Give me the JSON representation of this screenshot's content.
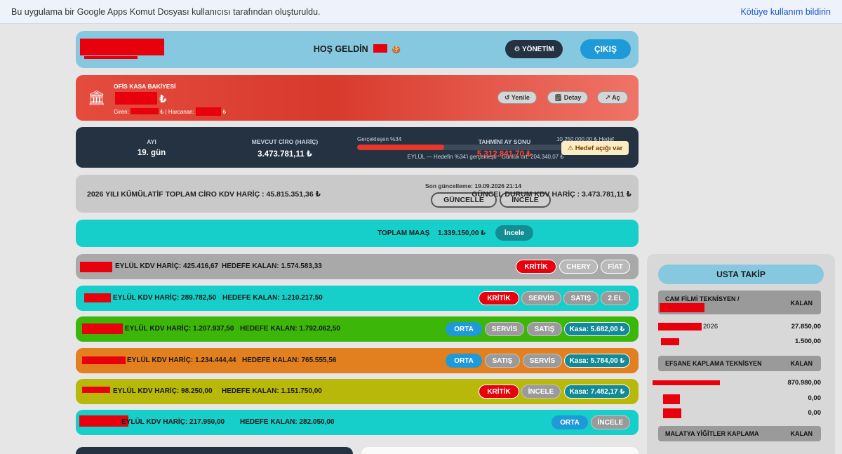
{
  "notice": {
    "text": "Bu uygulama bir Google Apps Komut Dosyası kullanıcısı tarafından oluşturuldu.",
    "report": "Kötüye kullanım bildirin"
  },
  "header": {
    "welcome": "HOŞ GELDİN",
    "icon": "🍪",
    "admin_button": "⚙ YÖNETİM",
    "logout_button": "ÇIKIŞ"
  },
  "kasa": {
    "bank_icon": "🏛",
    "label": "OFİS KASA BAKİYESİ",
    "amount_currency": "₺",
    "giren_label": "Giren:",
    "sep": "₺ | Harcanan:",
    "end": "₺",
    "refresh": "↺ Yenile",
    "detail": "🗒 Detay",
    "open": "↗ Aç"
  },
  "month": {
    "ay_label": "AYI",
    "ay_value": "19. gün",
    "ciro_label": "MEVCUT CİRO (HARİÇ)",
    "ciro_value": "3.473.781,11 ₺",
    "progress_label": "Gerçekleşen %34",
    "target": "10.250.000,00 ₺ Hedef",
    "progress_percent": 34,
    "progress_note": "EYLÜL — Hedefin %34'i gerçekleşti · Günlük ort: 204.340,07 ₺",
    "forecast_label": "TAHMİNİ AY SONU",
    "forecast_value": "5.312.841,70 ₺",
    "gap_badge": "⚠ Hedef açığı var"
  },
  "cumulative": {
    "left": "2026 YILI KÜMÜLATİF TOPLAM CİRO KDV HARİÇ : 45.815.351,36 ₺",
    "updated": "Son güncelleme: 19.09.2026 21:14",
    "refresh_button": "GÜNCELLE",
    "inspect_button": "İNCELE",
    "right": "GÜNCEL DURUM KDV HARİÇ : 3.473.781,11 ₺"
  },
  "salary": {
    "label": "TOPLAM MAAŞ",
    "value": "1.339.150,00 ₺",
    "button": "İncele"
  },
  "branches": [
    {
      "sales": "EYLÜL KDV HARİÇ: 425.416,67",
      "remaining": "HEDEFE KALAN: 1.574.583,33",
      "buttons": [
        "KRİTİK",
        "CHERY",
        "FİAT"
      ]
    },
    {
      "sales": "EYLÜL KDV HARİÇ: 289.782,50",
      "remaining": "HEDEFE KALAN: 1.210.217,50",
      "buttons": [
        "KRİTİK",
        "SERVİS",
        "SATIŞ",
        "2.EL"
      ]
    },
    {
      "sales": "EYLÜL KDV HARİÇ: 1.207.937,50",
      "remaining": "HEDEFE KALAN: 1.792.062,50",
      "buttons": [
        "ORTA",
        "SERVİS",
        "SATIŞ",
        "Kasa: 5.682,00 ₺"
      ]
    },
    {
      "sales": "EYLÜL KDV HARİÇ: 1.234.444,44",
      "remaining": "HEDEFE KALAN: 765.555,56",
      "buttons": [
        "ORTA",
        "SATIŞ",
        "SERVİS",
        "Kasa: 5.784,00 ₺"
      ]
    },
    {
      "sales": "EYLÜL KDV HARİÇ: 98.250,00",
      "remaining": "HEDEFE KALAN: 1.151.750,00",
      "buttons": [
        "KRİTİK",
        "İNCELE",
        "Kasa: 7.482,17 ₺"
      ]
    },
    {
      "sales": "EYLÜL KDV HARİÇ: 217.950,00",
      "remaining": "HEDEFE KALAN: 282.050,00",
      "buttons": [
        "ORTA",
        "İNCELE"
      ]
    }
  ],
  "colors": {
    "branch_1": "#a9a9a9",
    "branch_2": "#17cfca",
    "branch_3": "#3cb609",
    "branch_4": "#e2801f",
    "branch_5": "#b8b80a",
    "branch_6": "#17cfca"
  },
  "usta": {
    "title": "USTA TAKİP",
    "groups": [
      {
        "name": "CAM FİLMİ TEKNİSYEN /",
        "kalan": "KALAN",
        "rows": [
          {
            "label": "2026",
            "value": "27.850,00"
          },
          {
            "label": "",
            "value": "1.500,00"
          }
        ]
      },
      {
        "name": "EFSANE KAPLAMA TEKNİSYEN",
        "kalan": "KALAN",
        "rows": [
          {
            "label": "",
            "value": "870.980,00"
          },
          {
            "label": "",
            "value": "0,00"
          },
          {
            "label": "",
            "value": "0,00"
          }
        ]
      },
      {
        "name": "MALATYA YİĞİTLER KAPLAMA",
        "kalan": "KALAN",
        "rows": []
      }
    ]
  }
}
